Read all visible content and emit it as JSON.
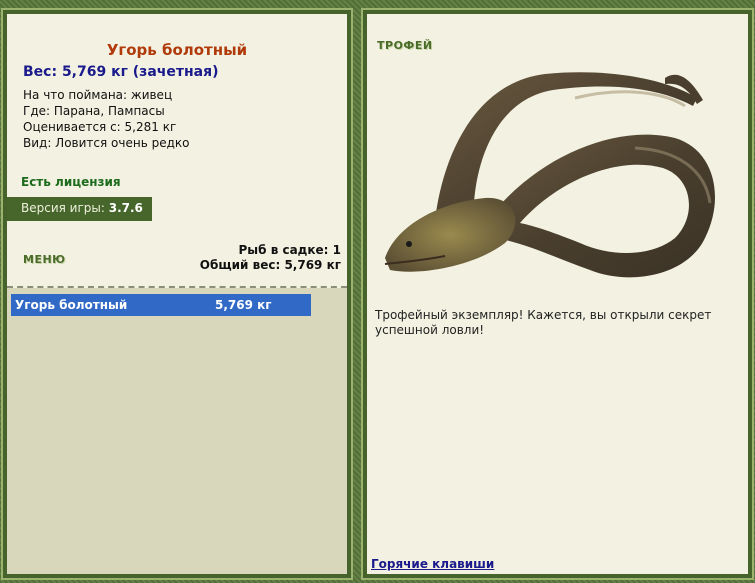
{
  "left": {
    "fish_name": "Угорь болотный",
    "weight": "Вес: 5,769 кг (зачетная)",
    "info": [
      "На что поймана: живец",
      "Где: Парана, Пампасы",
      "Оценивается с: 5,281 кг",
      "Вид: Ловится очень редко"
    ],
    "license": "Есть лицензия",
    "version_label": "Версия игры:",
    "version_value": "3.7.6",
    "menu_label": "МЕНЮ",
    "fish_count": "Рыб в садке: 1",
    "total_weight": "Общий вес: 5,769 кг",
    "catch_list": [
      {
        "name": "Угорь болотный",
        "weight": "5,769 кг"
      }
    ]
  },
  "right": {
    "trophy_label": "ТРОФЕЙ",
    "description": "Трофейный экземпляр! Кажется, вы открыли секрет успешной ловли!",
    "hotkeys_link": "Горячие клавиши"
  },
  "colors": {
    "frame": "#5c7a3c",
    "panel_bg": "#f3f2e2",
    "fish_name": "#b03a0a",
    "weight": "#1a1a8c",
    "license": "#1d6b1d",
    "selected_row": "#3169c6"
  }
}
